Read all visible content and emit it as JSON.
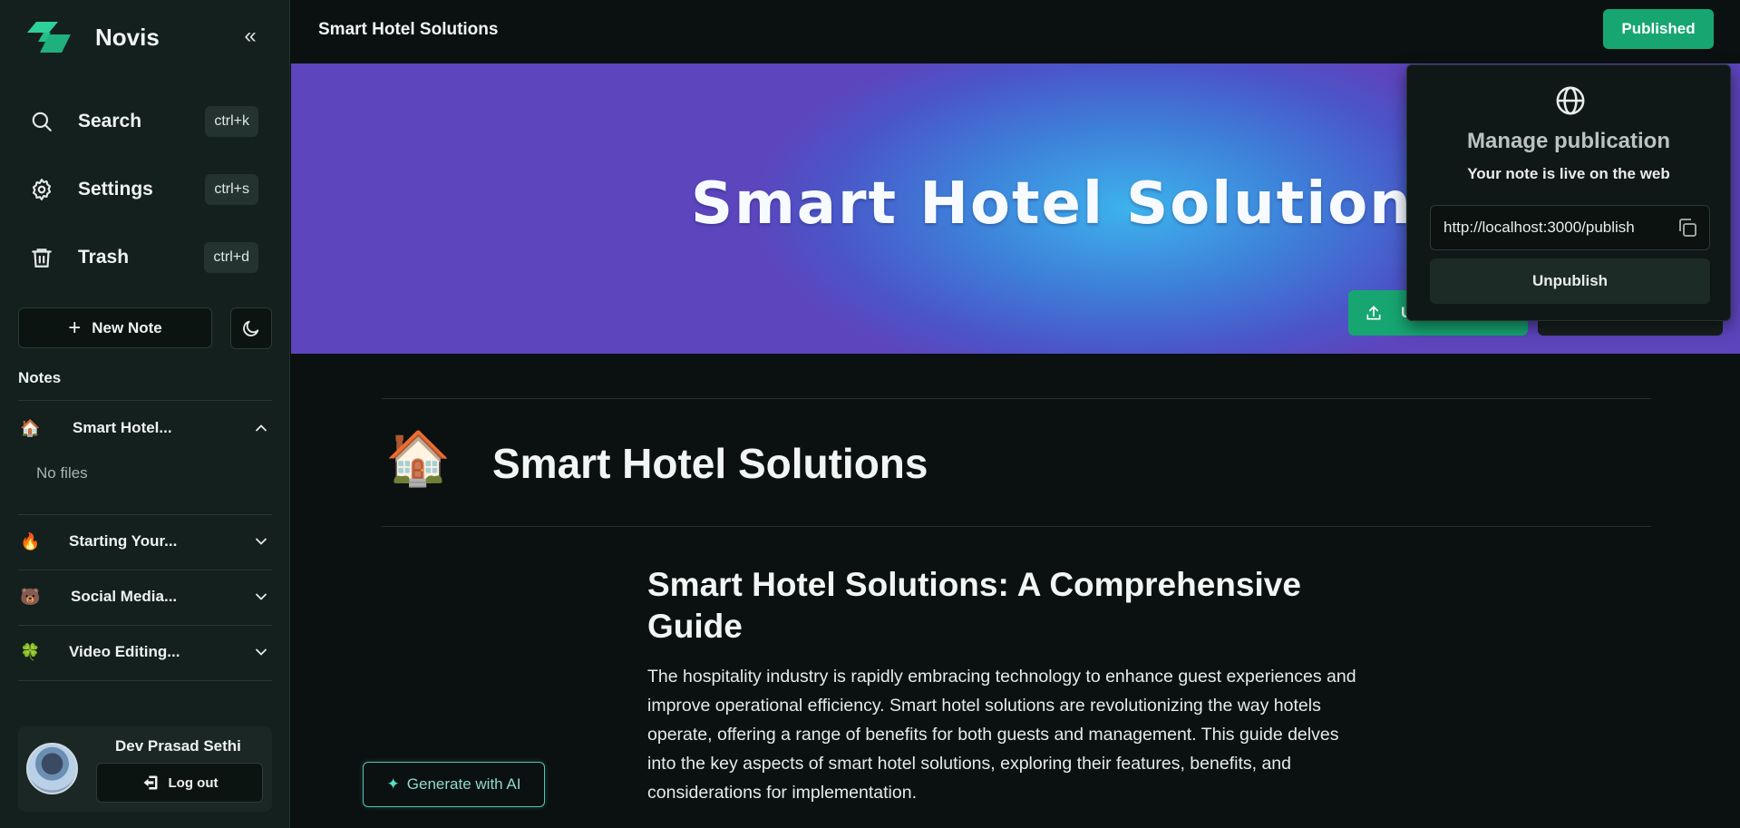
{
  "sidebar": {
    "brand": "Novis",
    "nav": [
      {
        "label": "Search",
        "shortcut": "ctrl+k",
        "icon": "search-icon"
      },
      {
        "label": "Settings",
        "shortcut": "ctrl+s",
        "icon": "gear-icon"
      },
      {
        "label": "Trash",
        "shortcut": "ctrl+d",
        "icon": "trash-icon"
      }
    ],
    "new_note_label": "New Note",
    "notes_heading": "Notes",
    "notes": [
      {
        "emoji": "🏠",
        "title": "Smart Hotel...",
        "expanded": true
      },
      {
        "emoji": "🔥",
        "title": "Starting Your...",
        "expanded": false
      },
      {
        "emoji": "🐻",
        "title": "Social Media...",
        "expanded": false
      },
      {
        "emoji": "🍀",
        "title": "Video Editing...",
        "expanded": false
      }
    ],
    "no_files_text": "No files",
    "user": {
      "name": "Dev Prasad Sethi",
      "logout_label": "Log out"
    }
  },
  "topbar": {
    "title": "Smart Hotel Solutions",
    "published_label": "Published"
  },
  "cover": {
    "title": "Smart Hotel Solutions",
    "upload_label": "U"
  },
  "popover": {
    "title": "Manage publication",
    "subtitle": "Your note is live on the web",
    "url": "http://localhost:3000/publish",
    "unpublish_label": "Unpublish"
  },
  "document": {
    "emoji": "🏠",
    "title": "Smart Hotel Solutions",
    "heading": "Smart Hotel Solutions: A Comprehensive Guide",
    "paragraph": "The hospitality industry is rapidly embracing technology to enhance guest experiences and improve operational efficiency. Smart hotel solutions are revolutionizing the way hotels operate, offering a range of benefits for both guests and management. This guide delves into the key aspects of smart hotel solutions, exploring their features, benefits, and considerations for implementation."
  },
  "generate_ai_label": "Generate with AI",
  "colors": {
    "accent": "#17a672",
    "sidebar_bg": "#13201d",
    "page_bg": "#0b1110",
    "ai_border": "#52c3b8"
  }
}
